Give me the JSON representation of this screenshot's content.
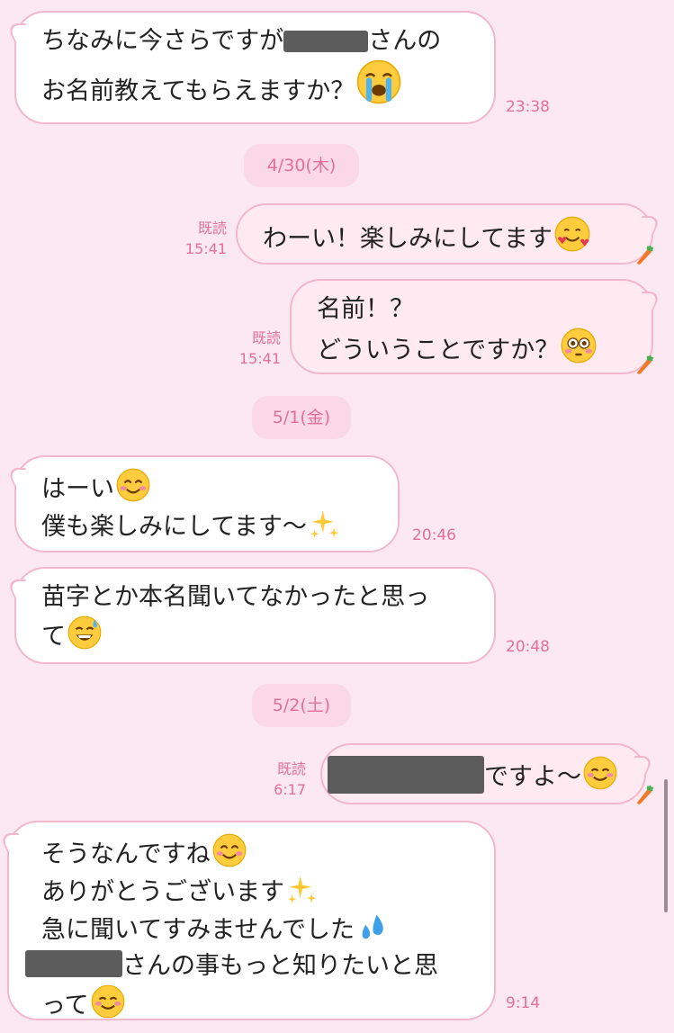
{
  "messages": [
    {
      "lines": [
        "ちなみに今さらですが",
        "さんの",
        "お名前教えてもらえますか？"
      ],
      "time": "23:38"
    },
    {
      "date": "4/30(木)"
    },
    {
      "text": "わーい！楽しみにしてます",
      "read": "既読",
      "time": "15:41"
    },
    {
      "lines": [
        "名前！？",
        "どういうことですか？"
      ],
      "read": "既読",
      "time": "15:41"
    },
    {
      "date": "5/1(金)"
    },
    {
      "lines": [
        "はーい",
        "僕も楽しみにしてます〜"
      ],
      "time": "20:46"
    },
    {
      "lines": [
        "苗字とか本名聞いてなかったと思っ",
        "て"
      ],
      "time": "20:48"
    },
    {
      "date": "5/2(土)"
    },
    {
      "text": "ですよ〜",
      "read": "既読",
      "time": "6:17"
    },
    {
      "lines": [
        "そうなんですね",
        "ありがとうございます",
        "急に聞いてすみませんでした",
        "さんの事もっと知りたいと思",
        "って"
      ],
      "time": "9:14"
    }
  ],
  "icons": [
    "loudly-crying-face",
    "smiling-face-with-hearts",
    "flushed-face",
    "smiling-face-with-smiling-eyes",
    "sparkles",
    "grinning-face-with-sweat",
    "smiling-face",
    "sweat-droplets",
    "carrot"
  ],
  "colors": {
    "background": "#fbe8f1",
    "bubble_border": "#f2b6cd",
    "accent": "#e0709a",
    "out_bubble": "#ffeaf2"
  }
}
